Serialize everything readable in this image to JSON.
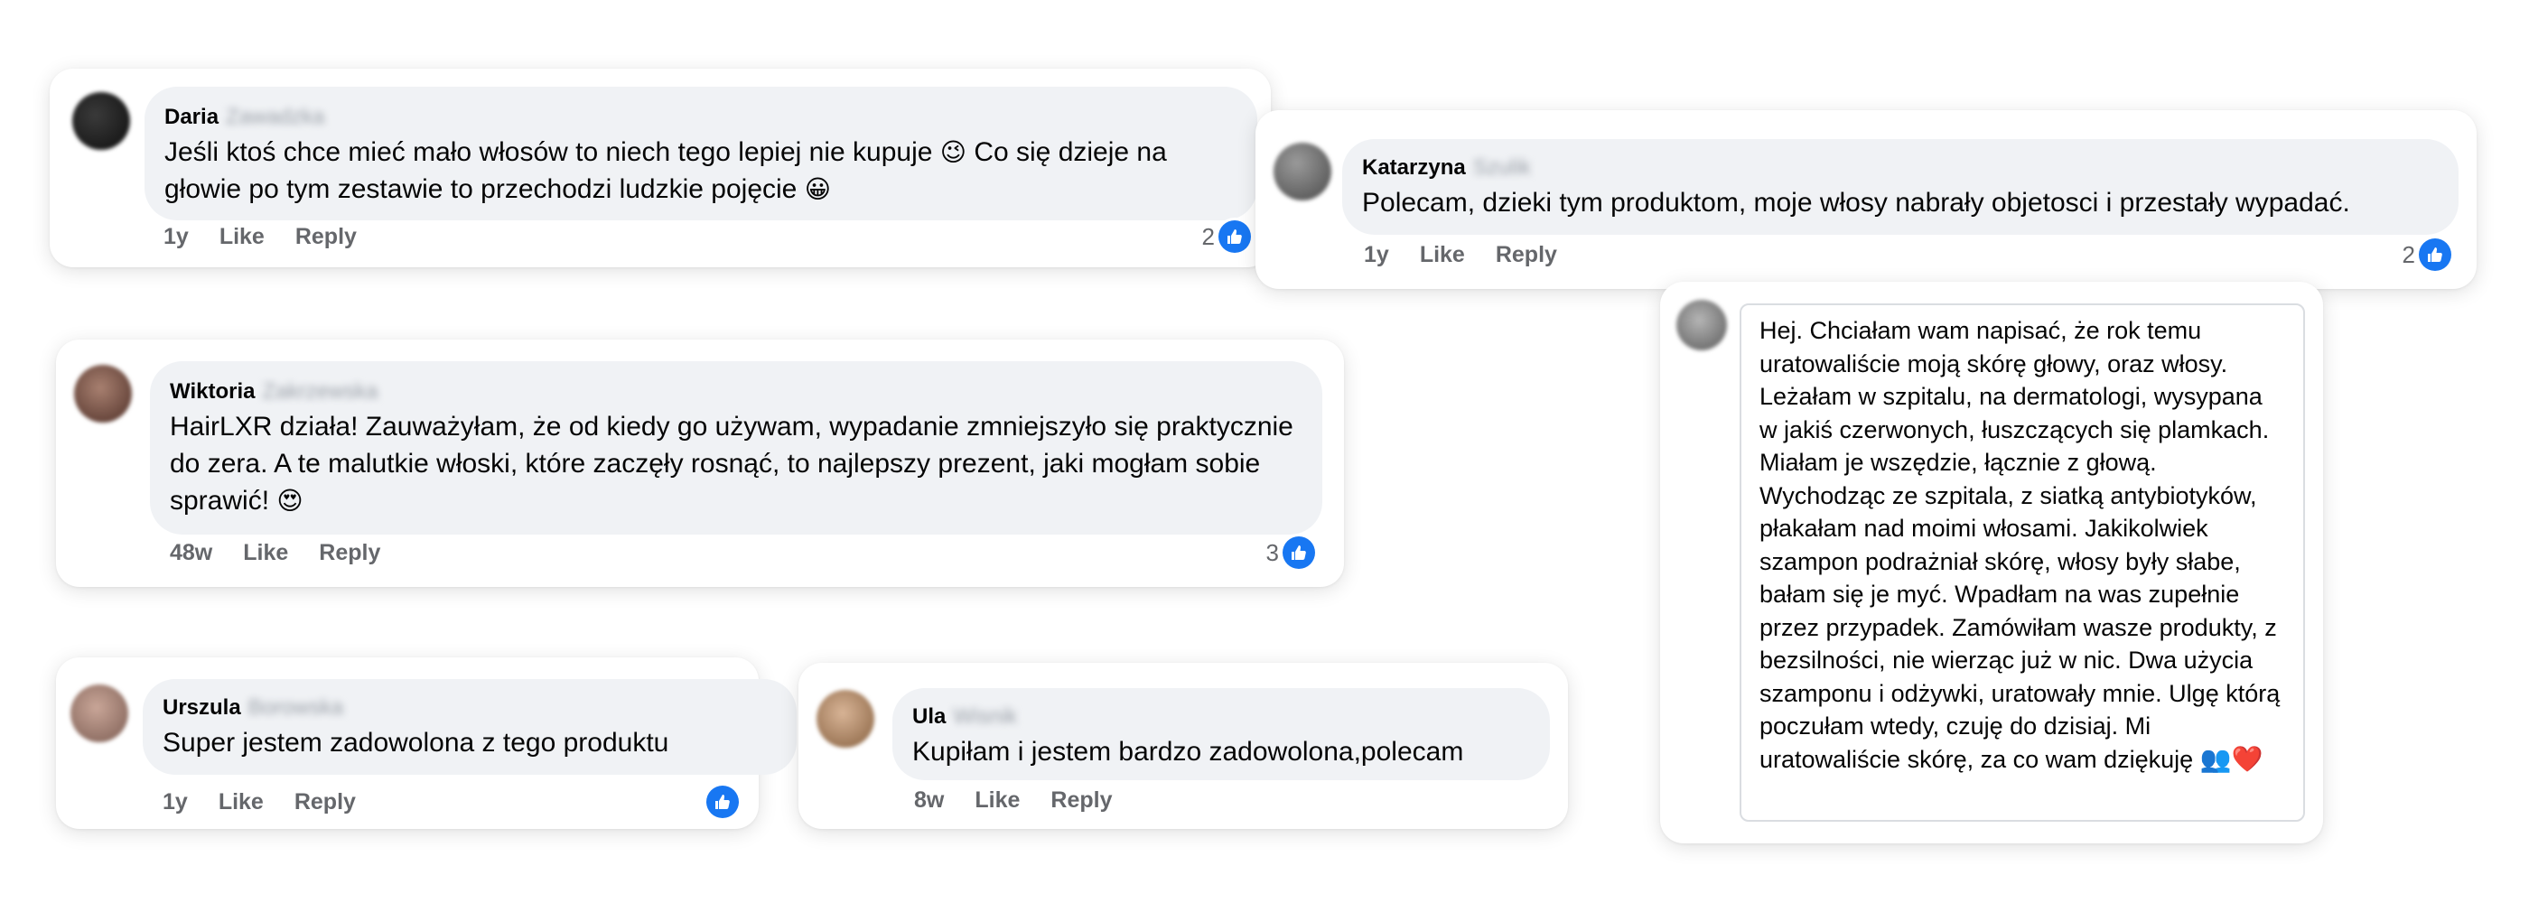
{
  "comments": [
    {
      "author_first": "Daria",
      "author_last": "Zawadzka",
      "text": "Jeśli ktoś chce mieć mało włosów to niech tego lepiej nie kupuje",
      "emoji1": "😉",
      "text2": "Co się dzieje na głowie po tym zestawie to przechodzi ludzkie pojęcie",
      "emoji2": "😀",
      "time": "1y",
      "like_label": "Like",
      "reply_label": "Reply",
      "reaction_count": "2",
      "avatar_color": "#1c1c1c"
    },
    {
      "author_first": "Katarzyna",
      "author_last": "Szulik",
      "text": "Polecam, dzieki tym produktom, moje włosy nabrały objetosci i przestały wypadać.",
      "time": "1y",
      "like_label": "Like",
      "reply_label": "Reply",
      "reaction_count": "2",
      "avatar_color": "#6d6d6d"
    },
    {
      "author_first": "Wiktoria",
      "author_last": "Zakrzewska",
      "text": "HairLXR działa! Zauważyłam, że od kiedy go używam, wypadanie zmniejszyło się praktycznie do zera. A te malutkie włoski, które zaczęły rosnąć, to najlepszy prezent, jaki mogłam sobie sprawić!",
      "emoji1": "😍",
      "time": "48w",
      "like_label": "Like",
      "reply_label": "Reply",
      "reaction_count": "3",
      "avatar_color": "#7a5a4c"
    },
    {
      "author_first": "Urszula",
      "author_last": "Borowska",
      "text": "Super jestem zadowolona z tego produktu",
      "time": "1y",
      "like_label": "Like",
      "reply_label": "Reply",
      "avatar_color": "#9a7d70"
    },
    {
      "author_first": "Ula",
      "author_last": "Wisnik",
      "text": "Kupiłam i jestem bardzo zadowolona,polecam",
      "time": "8w",
      "like_label": "Like",
      "reply_label": "Reply",
      "avatar_color": "#b58f72"
    }
  ],
  "long_comment": {
    "text": "Hej. Chciałam wam napisać, że rok temu uratowaliście moją skórę głowy, oraz włosy. Leżałam w szpitalu, na dermatologi, wysypana w jakiś czerwonych, łuszczących się plamkach. Miałam je wszędzie, łącznie z głową. Wychodząc ze szpitala, z siatką antybiotyków, płakałam nad moimi włosami. Jakikolwiek szampon podrażniał skórę, włosy były słabe, bałam się je myć. Wpadłam na was zupełnie przez przypadek. Zamówiłam wasze produkty, z bezsilności, nie wierząc już w nic. Dwa użycia szamponu i odżywki, uratowały mnie. Ulgę którą poczułam wtedy, czuję do dzisiaj. Mi uratowaliście skórę, za co wam dziękuję",
    "emoji": "👥❤️",
    "avatar_color": "#8a8a8a"
  },
  "icons": {
    "like": "like-thumb-icon"
  },
  "colors": {
    "like_blue": "#1877f2",
    "bubble": "#f0f2f5",
    "meta": "#65676b"
  }
}
